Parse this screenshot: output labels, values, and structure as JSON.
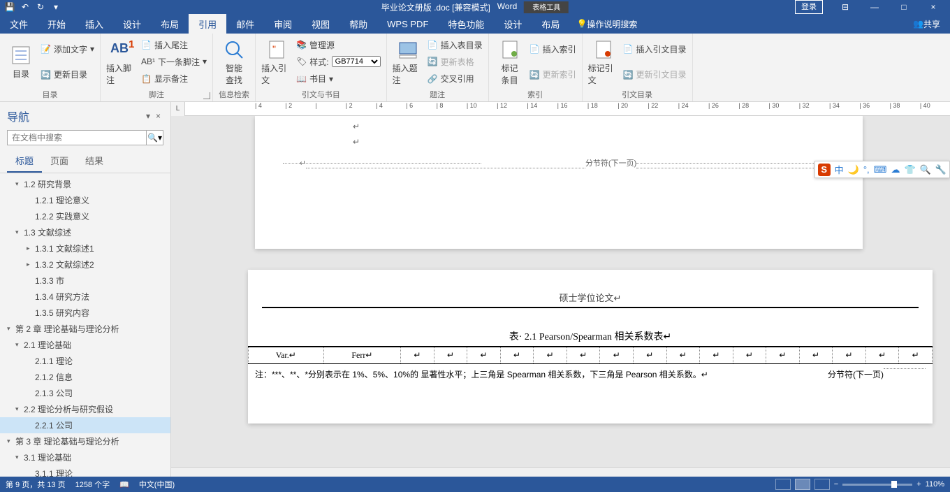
{
  "titlebar": {
    "doc_title": "毕业论文册版 .doc [兼容模式]",
    "app_name": "Word",
    "tabletools": "表格工具",
    "login": "登录"
  },
  "tabs": {
    "file": "文件",
    "home": "开始",
    "insert": "插入",
    "design": "设计",
    "layout": "布局",
    "references": "引用",
    "mail": "邮件",
    "review": "审阅",
    "view": "视图",
    "help": "帮助",
    "wps": "WPS PDF",
    "special": "特色功能",
    "tdesign": "设计",
    "tlayout": "布局",
    "tellme": "操作说明搜索",
    "share": "共享"
  },
  "ribbon": {
    "toc": {
      "btn": "目录",
      "add_text": "添加文字",
      "update": "更新目录",
      "group": "目录"
    },
    "footnote": {
      "btn": "插入脚注",
      "endnote": "插入尾注",
      "next": "下一条脚注",
      "show": "显示备注",
      "group": "脚注"
    },
    "search": {
      "btn": "智能\n查找",
      "group": "信息检索"
    },
    "citation": {
      "btn": "插入引文",
      "manage": "管理源",
      "style_lbl": "样式:",
      "style_val": "GB7714",
      "biblio": "书目",
      "group": "引文与书目"
    },
    "caption": {
      "btn": "插入题注",
      "ins_tof": "插入表目录",
      "update_tof": "更新表格",
      "crossref": "交叉引用",
      "group": "题注"
    },
    "index": {
      "btn": "标记\n条目",
      "ins": "插入索引",
      "update": "更新索引",
      "group": "索引"
    },
    "toa": {
      "btn": "标记引文",
      "ins": "插入引文目录",
      "update": "更新引文目录",
      "group": "引文目录"
    }
  },
  "nav": {
    "title": "导航",
    "search_placeholder": "在文档中搜索",
    "tabs": {
      "headings": "标题",
      "pages": "页面",
      "results": "结果"
    },
    "tree": [
      {
        "lvl": 1,
        "arrow": "▾",
        "text": "1.2 研究背景"
      },
      {
        "lvl": 2,
        "arrow": "",
        "text": "1.2.1 理论意义"
      },
      {
        "lvl": 2,
        "arrow": "",
        "text": "1.2.2 实践意义"
      },
      {
        "lvl": 1,
        "arrow": "▾",
        "text": "1.3 文献综述"
      },
      {
        "lvl": 2,
        "arrow": "▸",
        "text": "1.3.1 文献综述1"
      },
      {
        "lvl": 2,
        "arrow": "▸",
        "text": "1.3.2 文献综述2"
      },
      {
        "lvl": 2,
        "arrow": "",
        "text": "1.3.3 市"
      },
      {
        "lvl": 2,
        "arrow": "",
        "text": "1.3.4 研究方法"
      },
      {
        "lvl": 2,
        "arrow": "",
        "text": "1.3.5 研究内容"
      },
      {
        "lvl": 0,
        "arrow": "▾",
        "text": "第 2 章 理论基础与理论分析"
      },
      {
        "lvl": 1,
        "arrow": "▾",
        "text": "2.1 理论基础"
      },
      {
        "lvl": 2,
        "arrow": "",
        "text": "2.1.1 理论"
      },
      {
        "lvl": 2,
        "arrow": "",
        "text": "2.1.2 信息"
      },
      {
        "lvl": 2,
        "arrow": "",
        "text": "2.1.3 公司"
      },
      {
        "lvl": 1,
        "arrow": "▾",
        "text": "2.2 理论分析与研究假设"
      },
      {
        "lvl": 2,
        "arrow": "",
        "text": "2.2.1 公司",
        "selected": true
      },
      {
        "lvl": 0,
        "arrow": "▾",
        "text": "第 3 章 理论基础与理论分析"
      },
      {
        "lvl": 1,
        "arrow": "▾",
        "text": "3.1 理论基础"
      },
      {
        "lvl": 2,
        "arrow": "",
        "text": "3.1.1 理论"
      }
    ]
  },
  "doc": {
    "section_break": "分节符(下一页)",
    "page_header": "硕士学位论文↵",
    "table_caption": "表· 2.1 Pearson/Spearman 相关系数表↵",
    "cells": [
      "Var.↵",
      "Ferr↵",
      "↵",
      "↵",
      "↵",
      "↵",
      "↵",
      "↵",
      "↵",
      "↵",
      "↵",
      "↵",
      "↵",
      "↵",
      "↵",
      "↵",
      "↵",
      "↵"
    ],
    "note": "注：***、**、*分别表示在 1%、5%、10%的 显著性水平；上三角是 Spearman 相关系数，下三角是 Pearson 相关系数。↵",
    "note_break": "分节符(下一页)"
  },
  "ruler": [
    "4",
    "2",
    "",
    "2",
    "4",
    "6",
    "8",
    "10",
    "12",
    "14",
    "16",
    "18",
    "20",
    "22",
    "24",
    "26",
    "28",
    "30",
    "32",
    "34",
    "36",
    "38",
    "40"
  ],
  "ime": {
    "brand": "S",
    "lang": "中"
  },
  "status": {
    "page": "第 9 页，共 13 页",
    "words": "1258 个字",
    "lang": "中文(中国)",
    "zoom": "110%"
  }
}
